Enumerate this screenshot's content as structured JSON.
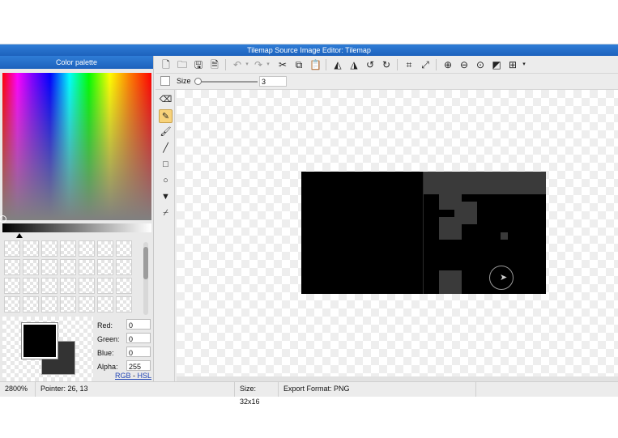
{
  "window": {
    "title": "Tilemap Source Image Editor: Tilemap"
  },
  "palette": {
    "title": "Color palette",
    "channels": [
      {
        "label": "Red:",
        "value": "0"
      },
      {
        "label": "Green:",
        "value": "0"
      },
      {
        "label": "Blue:",
        "value": "0"
      },
      {
        "label": "Alpha:",
        "value": "255"
      }
    ],
    "mode_rgb": "RGB",
    "mode_sep": " - ",
    "mode_hsl": "HSL",
    "foreground_color": "#000000",
    "background_color": "#333333"
  },
  "toolbar": {
    "icons": [
      "new-file-icon",
      "open-folder-icon",
      "save-icon",
      "save-as-icon",
      "undo-icon",
      "redo-icon",
      "cut-icon",
      "copy-icon",
      "paste-icon",
      "flip-horizontal-icon",
      "flip-vertical-icon",
      "rotate-left-icon",
      "rotate-right-icon",
      "crop-icon",
      "resize-icon",
      "zoom-in-icon",
      "zoom-out-icon",
      "zoom-reset-icon",
      "background-toggle-icon",
      "grid-icon"
    ]
  },
  "size_bar": {
    "label": "Size",
    "value": "3"
  },
  "tools": [
    "eraser-icon",
    "pencil-icon",
    "brush-icon",
    "line-icon",
    "rectangle-icon",
    "ellipse-icon",
    "fill-bucket-icon",
    "eyedropper-icon"
  ],
  "status": {
    "zoom": "2800%",
    "pointer": "Pointer: 26, 13",
    "size": "Size: 32x16",
    "export_format": "Export Format: PNG"
  }
}
